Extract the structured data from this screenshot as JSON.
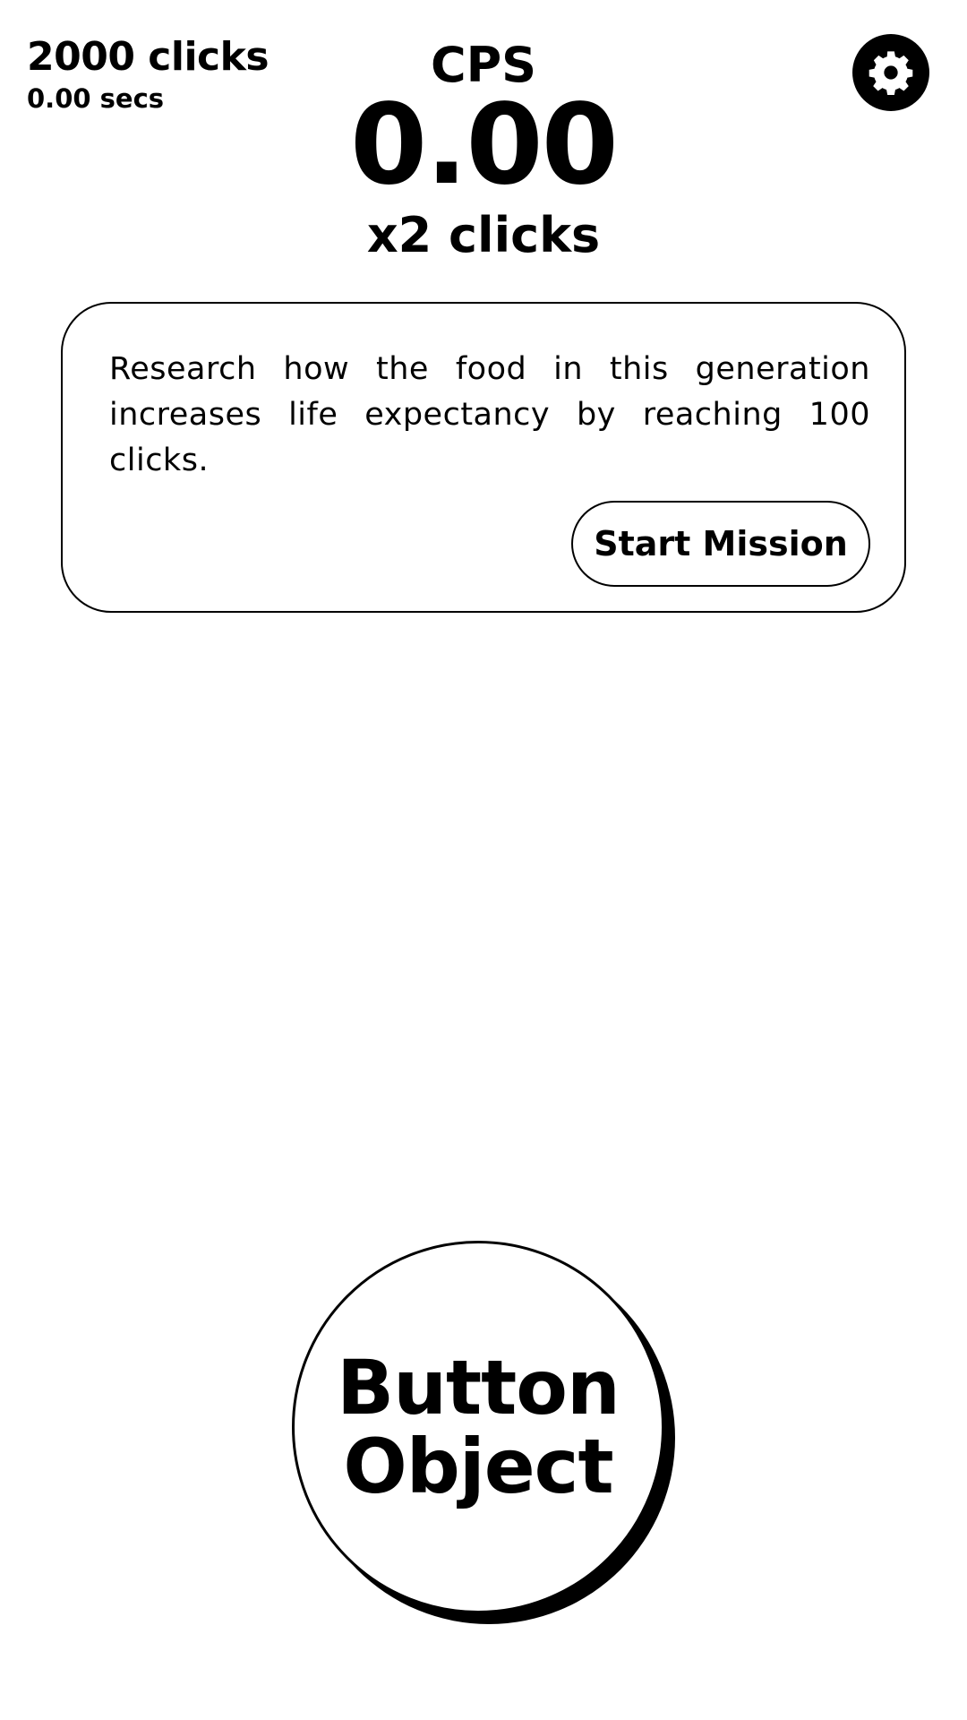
{
  "stats": {
    "clicks": "2000 clicks",
    "secs": "0.00 secs"
  },
  "cps": {
    "label": "CPS",
    "value": "0.00",
    "multiplier": "x2 clicks"
  },
  "settings": {
    "icon": "gear-icon"
  },
  "mission": {
    "text": "Research how the food in this generation increases life expectancy by reaching 100 clicks.",
    "button_label": "Start Mission"
  },
  "main_button": {
    "line1": "Button",
    "line2": "Object"
  },
  "colors": {
    "foreground": "#000000",
    "background": "#ffffff"
  }
}
